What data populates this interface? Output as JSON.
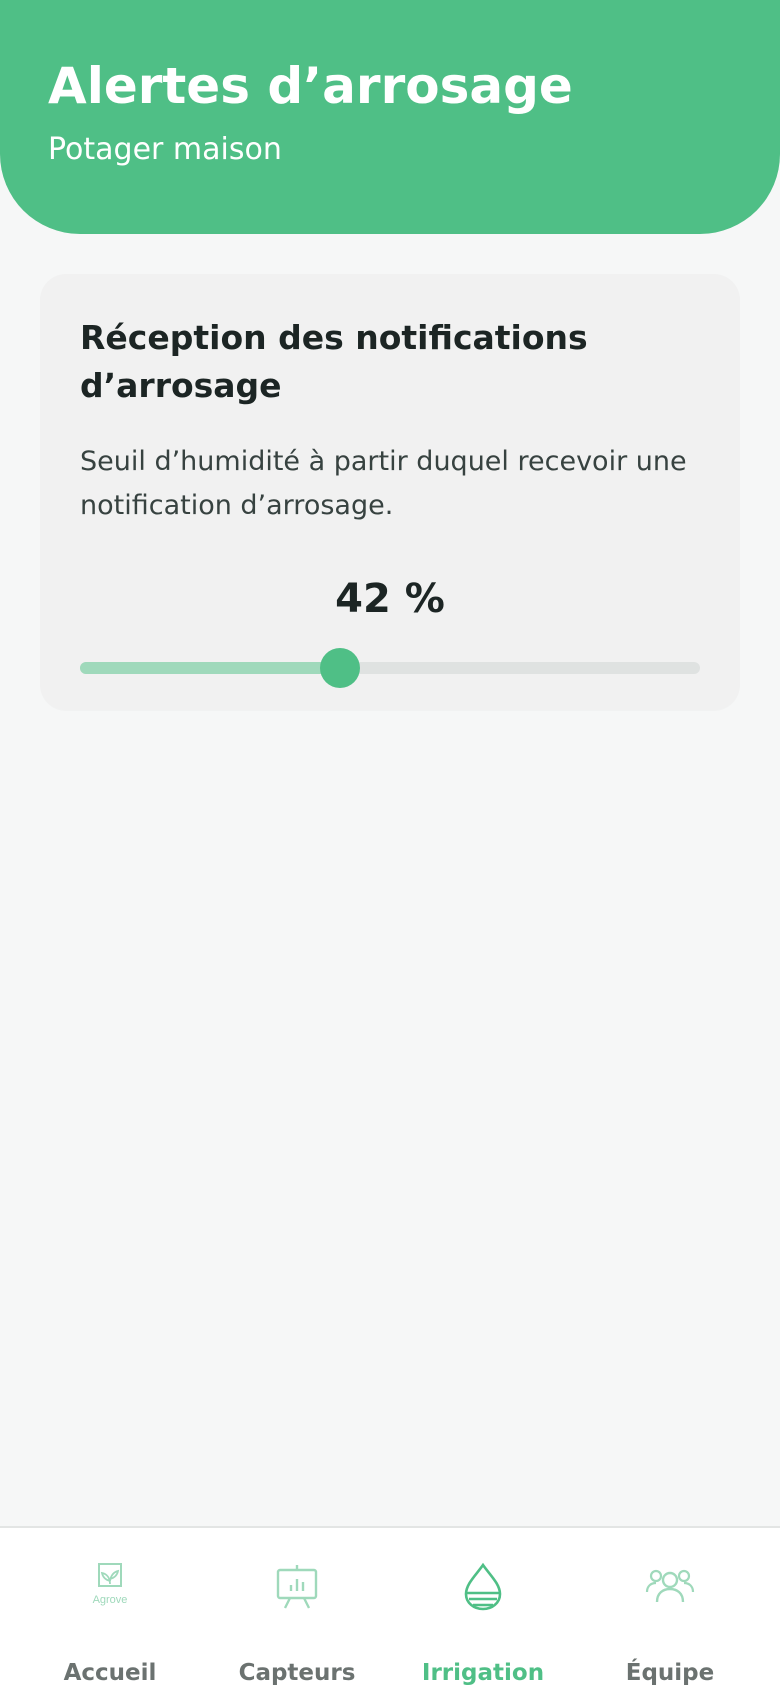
{
  "header": {
    "title": "Alertes d’arrosage",
    "subtitle": "Potager maison"
  },
  "card": {
    "title": "Réception des notifications d’arrosage",
    "description": "Seuil d’humidité à partir duquel recevoir une notification d’arrosage.",
    "value_label": "42 %",
    "slider": {
      "value": 42,
      "min": 0,
      "max": 100
    }
  },
  "colors": {
    "accent": "#4fbf86",
    "accent_light": "#9fd9bb",
    "track": "#dfe2e1",
    "inactive_label": "#6b7270"
  },
  "nav": {
    "items": [
      {
        "label": "Accueil",
        "icon": "agrove-logo-icon",
        "logo_text": "Agrove",
        "active": false
      },
      {
        "label": "Capteurs",
        "icon": "sensor-board-icon",
        "active": false
      },
      {
        "label": "Irrigation",
        "icon": "water-drop-icon",
        "active": true
      },
      {
        "label": "Équipe",
        "icon": "team-icon",
        "active": false
      }
    ]
  }
}
